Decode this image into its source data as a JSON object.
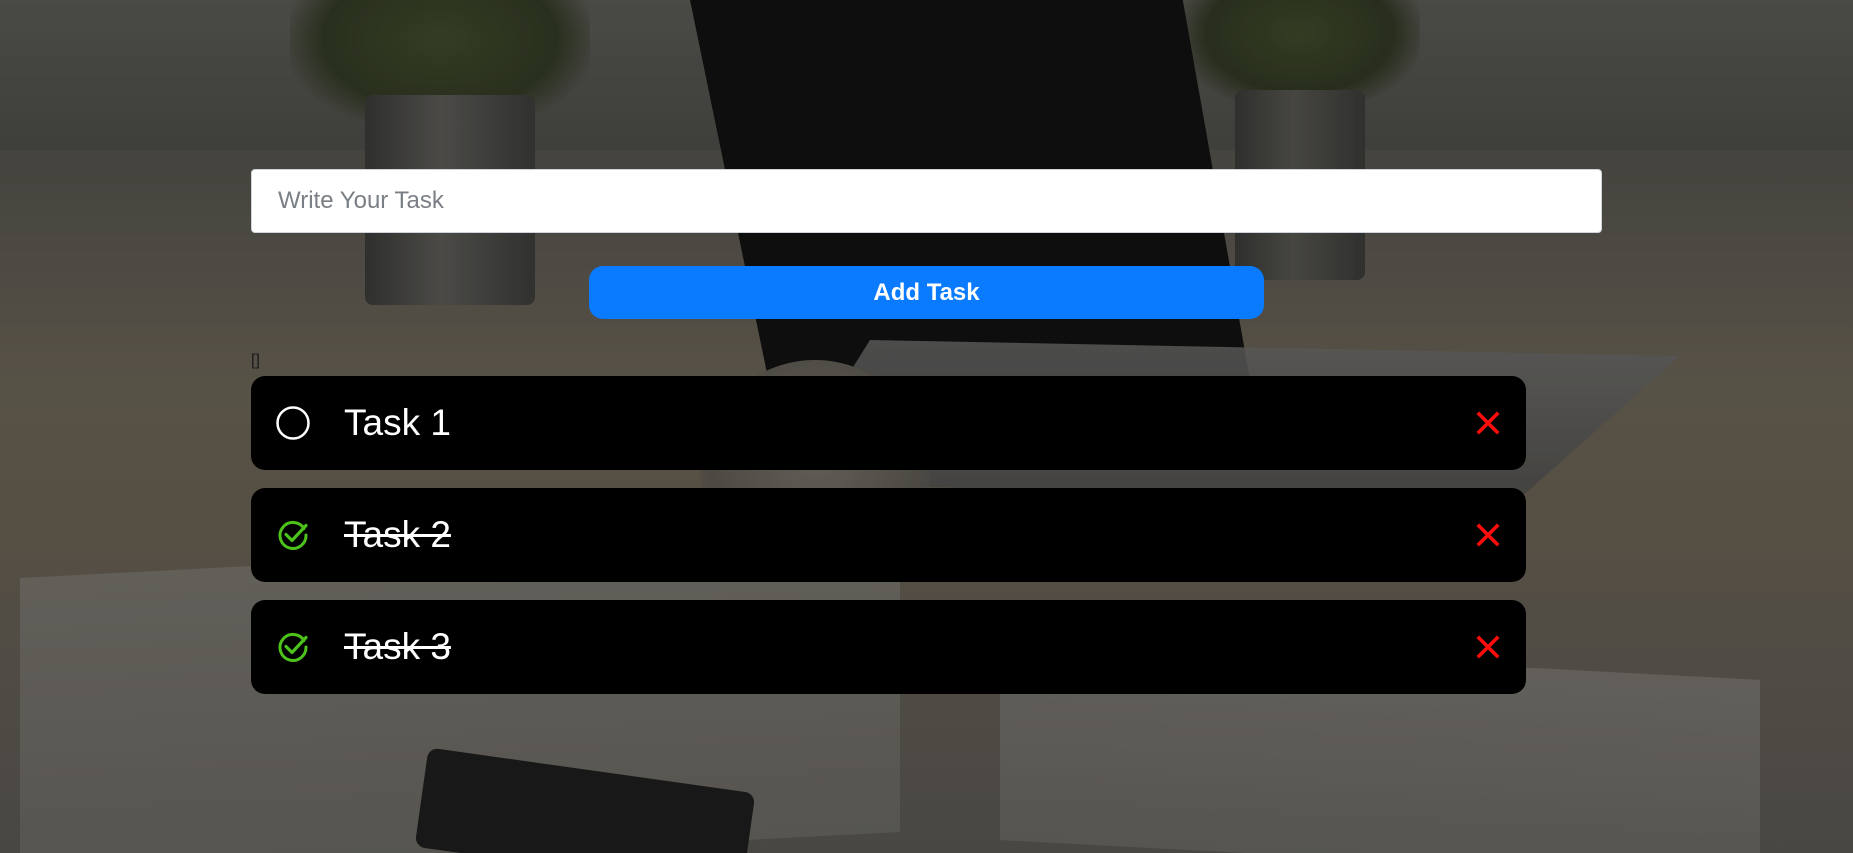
{
  "form": {
    "input_value": "",
    "input_placeholder": "Write Your Task",
    "add_button_label": "Add Task"
  },
  "debug_text": "[]",
  "tasks": [
    {
      "label": "Task 1",
      "completed": false
    },
    {
      "label": "Task 2",
      "completed": true
    },
    {
      "label": "Task 3",
      "completed": true
    }
  ],
  "icons": {
    "unchecked": "circle-outline-icon",
    "checked": "check-circle-icon",
    "delete": "close-x-icon"
  },
  "colors": {
    "accent": "#0a7bff",
    "check": "#4cc21a",
    "delete": "#ff0d0d",
    "task_bg": "#000000"
  }
}
